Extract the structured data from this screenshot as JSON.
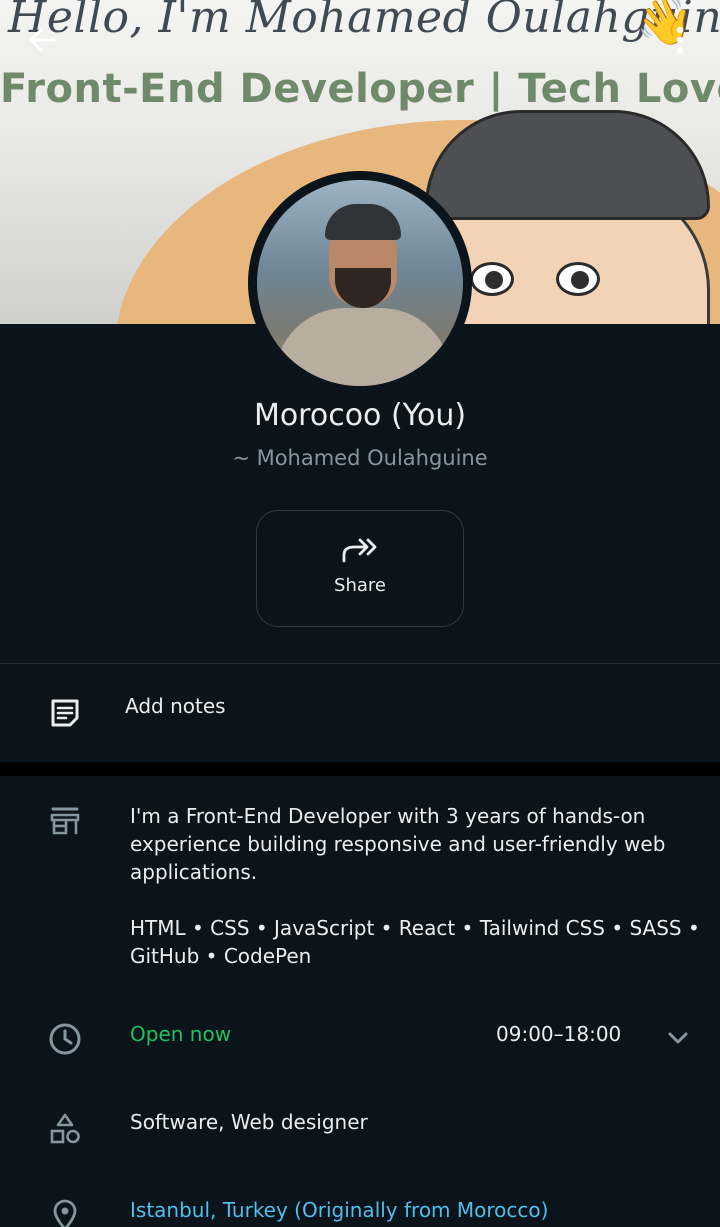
{
  "cover": {
    "headline": "Hello, I'm Mohamed Oulahguine",
    "tagline": "Front-End Developer | Tech Lover",
    "wave_emoji": "👋"
  },
  "header": {
    "back_icon": "arrow-left-icon",
    "menu_icon": "more-vertical-icon"
  },
  "profile": {
    "name": "Morocoo (You)",
    "subtitle": "~ Mohamed Oulahguine"
  },
  "actions": {
    "share_label": "Share",
    "share_icon": "share-forward-icon"
  },
  "notes": {
    "label": "Add notes",
    "icon": "notes-icon"
  },
  "business": {
    "about": "I'm a Front-End Developer with 3  years of hands-on experience building responsive and user-friendly web applications.",
    "skills": "HTML • CSS • JavaScript • React • Tailwind CSS • SASS • GitHub • CodePen",
    "status": "Open now",
    "hours": "09:00–18:00",
    "category": "Software, Web designer",
    "location": "Istanbul, Turkey (Originally from Morocco)"
  },
  "colors": {
    "background": "#0b141a",
    "open_status": "#21c063",
    "link": "#53bdeb",
    "secondary_text": "#8696a0"
  }
}
